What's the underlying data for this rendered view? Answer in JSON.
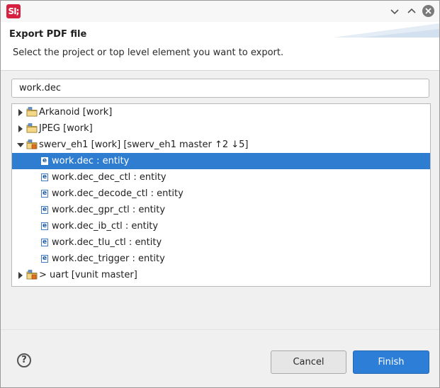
{
  "window": {
    "app_logo_text": "SI;",
    "title": "Export PDF file",
    "description": "Select the project or top level element you want to export."
  },
  "filter": {
    "value": "work.dec"
  },
  "tree": {
    "projects": [
      {
        "label": "Arkanoid [work]",
        "expanded": false
      },
      {
        "label": "JPEG [work]",
        "expanded": false
      },
      {
        "label": "swerv_eh1 [work] [swerv_eh1 master ↑2 ↓5]",
        "expanded": true,
        "children": [
          {
            "label": "work.dec : entity",
            "selected": true
          },
          {
            "label": "work.dec_dec_ctl : entity"
          },
          {
            "label": "work.dec_decode_ctl : entity"
          },
          {
            "label": "work.dec_gpr_ctl : entity"
          },
          {
            "label": "work.dec_ib_ctl : entity"
          },
          {
            "label": "work.dec_tlu_ctl : entity"
          },
          {
            "label": "work.dec_trigger : entity"
          }
        ]
      },
      {
        "label": "> uart [vunit master]",
        "expanded": false
      }
    ],
    "entity_icon_letter": "e"
  },
  "buttons": {
    "help": "?",
    "cancel": "Cancel",
    "finish": "Finish"
  },
  "colors": {
    "selection": "#2f7dd0",
    "accent": "#2d7ed6",
    "logo": "#d6203f"
  }
}
